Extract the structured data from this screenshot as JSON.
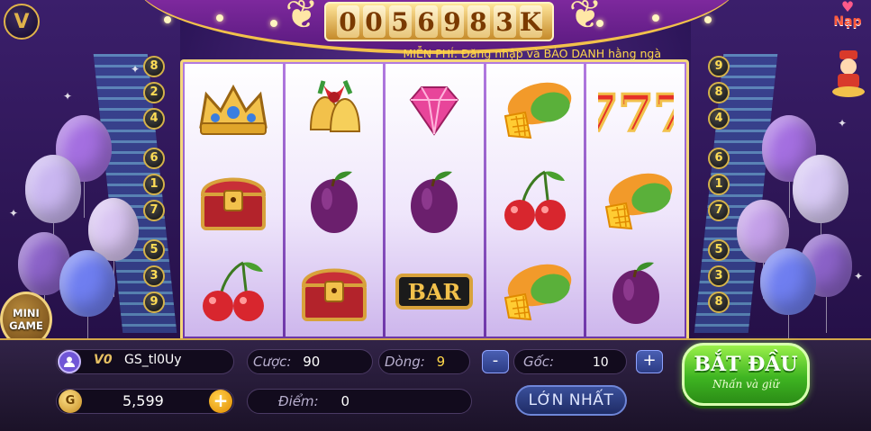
{
  "jackpot": {
    "digits": [
      "0",
      "0",
      "5",
      "6",
      "9",
      "8",
      "3",
      "K"
    ]
  },
  "ticker": {
    "text": "MIỄN PHÍ: Đăng nhập và BÁO DANH hằng ngà"
  },
  "top_right": {
    "nap_label": "Nạp"
  },
  "mini_game": {
    "line1": "MINI",
    "line2": "GAME"
  },
  "paylines": {
    "left": [
      "8",
      "2",
      "4",
      "6",
      "1",
      "7",
      "5",
      "3",
      "9"
    ],
    "right": [
      "9",
      "8",
      "4",
      "6",
      "1",
      "7",
      "5",
      "3",
      "8"
    ]
  },
  "reels": [
    [
      "crown",
      "chest",
      "cherry"
    ],
    [
      "bells",
      "plum",
      "chest"
    ],
    [
      "diamond",
      "plum",
      "BAR"
    ],
    [
      "mango",
      "cherry",
      "mango"
    ],
    [
      "777",
      "mango",
      "plum"
    ]
  ],
  "player": {
    "vip": "V0",
    "username": "GS_tl0Uy",
    "balance": "5,599",
    "coin_symbol": "G"
  },
  "controls": {
    "bet_label": "Cược:",
    "bet_value": "90",
    "lines_label": "Dòng:",
    "lines_value": "9",
    "base_label": "Gốc:",
    "base_value": "10",
    "score_label": "Điểm:",
    "score_value": "0",
    "minus": "-",
    "plus": "+",
    "max_label": "LỚN NHẤT",
    "start_title": "BẮT ĐẦU",
    "start_sub": "Nhấn và giữ"
  },
  "colors": {
    "accent_gold": "#e0b34a",
    "start_green": "#3fb522",
    "ticker_yellow": "#ffd84a"
  }
}
